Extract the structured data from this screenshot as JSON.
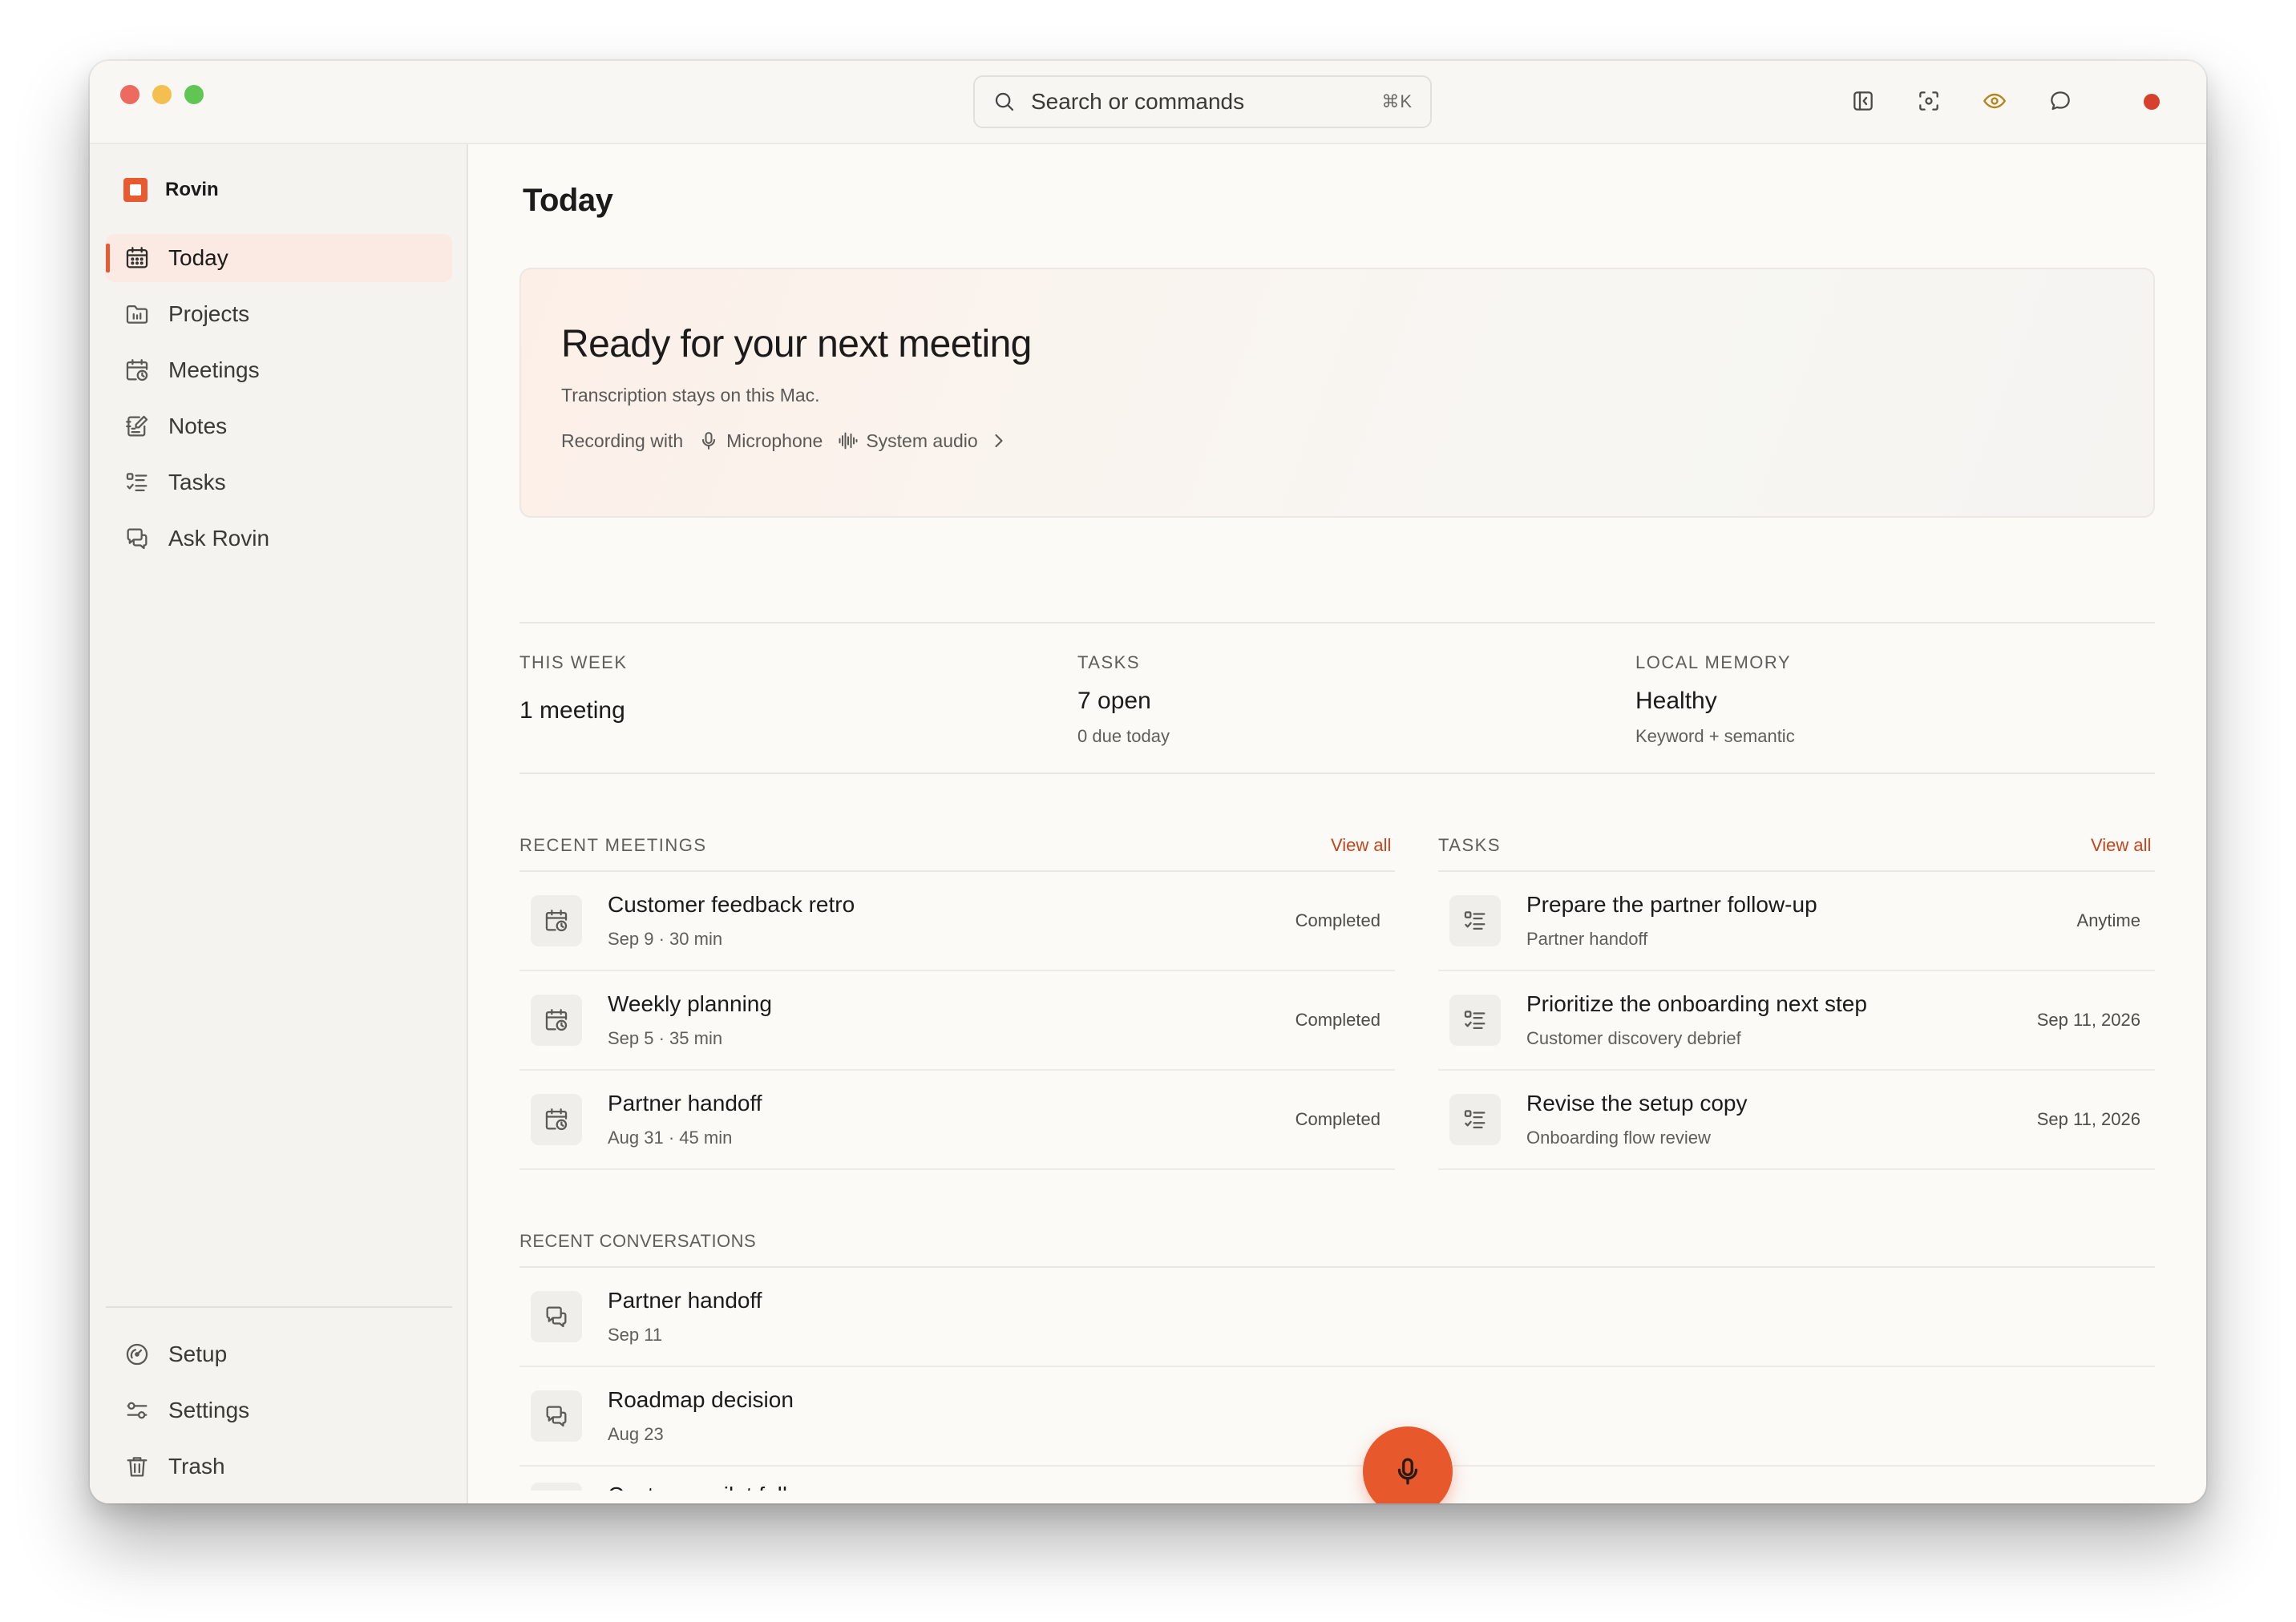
{
  "search": {
    "placeholder": "Search or commands",
    "shortcut": "⌘K"
  },
  "toolbar": {
    "icons": [
      "sidebar-toggle-icon",
      "screenshot-icon",
      "eye-icon",
      "chat-icon",
      "record-dot-icon"
    ]
  },
  "sidebar": {
    "brand": "Rovin",
    "items": [
      {
        "label": "Today",
        "icon": "calendar-icon",
        "active": true
      },
      {
        "label": "Projects",
        "icon": "folder-icon"
      },
      {
        "label": "Meetings",
        "icon": "calendar-clock-icon"
      },
      {
        "label": "Notes",
        "icon": "notes-icon"
      },
      {
        "label": "Tasks",
        "icon": "checklist-icon"
      },
      {
        "label": "Ask Rovin",
        "icon": "chat-icon"
      }
    ],
    "bottom_items": [
      {
        "label": "Setup",
        "icon": "gauge-icon"
      },
      {
        "label": "Settings",
        "icon": "sliders-icon"
      },
      {
        "label": "Trash",
        "icon": "trash-icon"
      }
    ]
  },
  "main": {
    "title": "Today",
    "hero": {
      "heading": "Ready for your next meeting",
      "subtitle": "Transcription stays on this Mac.",
      "recording_label": "Recording with",
      "microphone": "Microphone",
      "system_audio": "System audio"
    },
    "stats": [
      {
        "label": "THIS WEEK",
        "value": "1 meeting",
        "sub": ""
      },
      {
        "label": "TASKS",
        "value": "7 open",
        "sub": "0 due today"
      },
      {
        "label": "LOCAL MEMORY",
        "value": "Healthy",
        "sub": "Keyword + semantic"
      }
    ],
    "recent_meetings": {
      "label": "RECENT MEETINGS",
      "view_all": "View all",
      "rows": [
        {
          "title": "Customer feedback retro",
          "meta": "Sep 9 · 30 min",
          "status": "Completed"
        },
        {
          "title": "Weekly planning",
          "meta": "Sep 5 · 35 min",
          "status": "Completed"
        },
        {
          "title": "Partner handoff",
          "meta": "Aug 31 · 45 min",
          "status": "Completed"
        }
      ]
    },
    "tasks": {
      "label": "TASKS",
      "view_all": "View all",
      "rows": [
        {
          "title": "Prepare the partner follow-up",
          "meta": "Partner handoff",
          "due": "Anytime"
        },
        {
          "title": "Prioritize the onboarding next step",
          "meta": "Customer discovery debrief",
          "due": "Sep 11, 2026"
        },
        {
          "title": "Revise the setup copy",
          "meta": "Onboarding flow review",
          "due": "Sep 11, 2026"
        }
      ]
    },
    "recent_conversations": {
      "label": "RECENT CONVERSATIONS",
      "rows": [
        {
          "title": "Partner handoff",
          "meta": "Sep 11"
        },
        {
          "title": "Roadmap decision",
          "meta": "Aug 23"
        },
        {
          "title": "Customer pilot follow-up",
          "meta": ""
        }
      ]
    }
  },
  "colors": {
    "accent": "#e65b2f",
    "link": "#c2451e",
    "background": "#fbfaf7",
    "sidebar": "#f4f3ef"
  }
}
